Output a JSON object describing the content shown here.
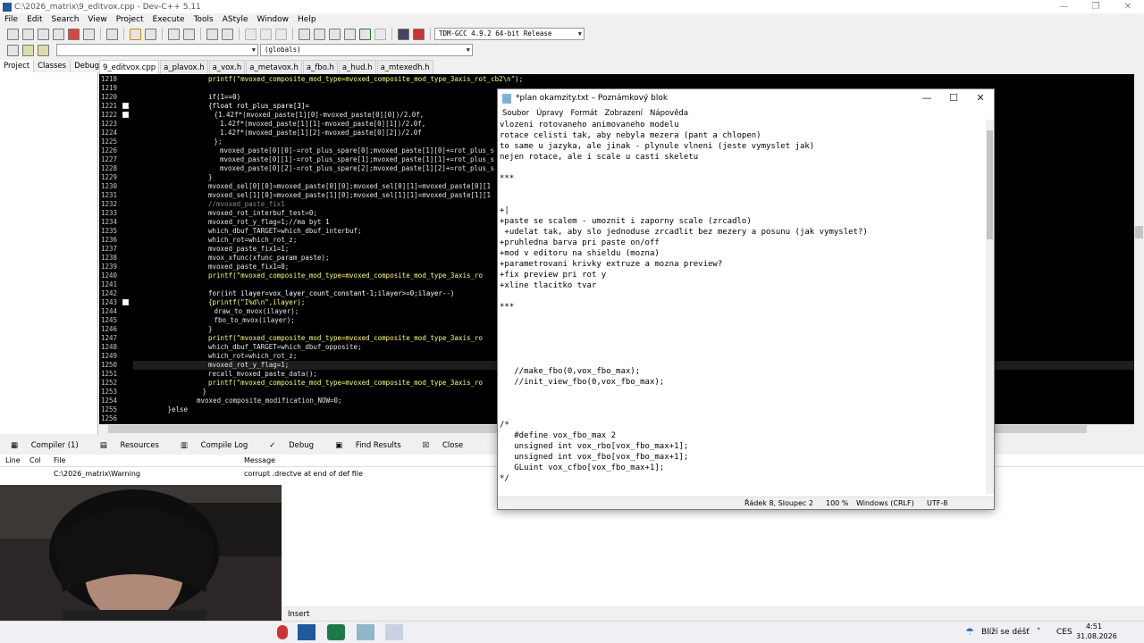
{
  "ide": {
    "title": "C:\\2026_matrix\\9_editvox.cpp - Dev-C++ 5.11",
    "menu": [
      "File",
      "Edit",
      "Search",
      "View",
      "Project",
      "Execute",
      "Tools",
      "AStyle",
      "Window",
      "Help"
    ],
    "compiler_select": "TDM-GCC 4.9.2 64-bit Release",
    "scope_select": "(globals)",
    "side_tabs": [
      "Project",
      "Classes",
      "Debug"
    ],
    "editor_tabs": [
      "9_editvox.cpp",
      "a_plavox.h",
      "a_vox.h",
      "a_metavox.h",
      "a_fbo.h",
      "a_hud.h",
      "a_mtexedh.h"
    ],
    "active_tab": "9_editvox.cpp",
    "code_lines": [
      {
        "n": "1218",
        "t": "printf(\"mvoxed_composite_mod_type=mvoxed_composite_mod_type_3axis_rot_cb2\\n\");",
        "i": 12
      },
      {
        "n": "1219",
        "t": "",
        "i": 0
      },
      {
        "n": "1220",
        "t": "if(1==0)",
        "i": 12
      },
      {
        "n": "1221",
        "t": "{float rot_plus_spare[3]=",
        "i": 12
      },
      {
        "n": "1222",
        "t": "{1.42f*(mvoxed_paste[1][0]-mvoxed_paste[0][0])/2.0f,",
        "i": 13
      },
      {
        "n": "1223",
        "t": "1.42f*(mvoxed_paste[1][1]-mvoxed_paste[0][1])/2.0f,",
        "i": 14
      },
      {
        "n": "1224",
        "t": "1.42f*(mvoxed_paste[1][2]-mvoxed_paste[0][2])/2.0f",
        "i": 14
      },
      {
        "n": "1225",
        "t": "};",
        "i": 13
      },
      {
        "n": "1226",
        "t": "mvoxed_paste[0][0]-=rot_plus_spare[0];mvoxed_paste[1][0]+=rot_plus_s",
        "i": 14
      },
      {
        "n": "1227",
        "t": "mvoxed_paste[0][1]-=rot_plus_spare[1];mvoxed_paste[1][1]+=rot_plus_s",
        "i": 14
      },
      {
        "n": "1228",
        "t": "mvoxed_paste[0][2]-=rot_plus_spare[2];mvoxed_paste[1][2]+=rot_plus_s",
        "i": 14
      },
      {
        "n": "1229",
        "t": "}",
        "i": 12
      },
      {
        "n": "1230",
        "t": "mvoxed_sel[0][0]=mvoxed_paste[0][0];mvoxed_sel[0][1]=mvoxed_paste[0][1",
        "i": 12
      },
      {
        "n": "1231",
        "t": "mvoxed_sel[1][0]=mvoxed_paste[1][0];mvoxed_sel[1][1]=mvoxed_paste[1][1",
        "i": 12
      },
      {
        "n": "1232",
        "t": "//mvoxed_paste_fix1",
        "i": 12
      },
      {
        "n": "1233",
        "t": "mvoxed_rot_interbuf_test=0;",
        "i": 12
      },
      {
        "n": "1234",
        "t": "mvoxed_rot_y_flag=1;//ma byt 1",
        "i": 12
      },
      {
        "n": "1235",
        "t": "which_dbuf_TARGET=which_dbuf_interbuf;",
        "i": 12
      },
      {
        "n": "1236",
        "t": "which_rot=which_rot_z;",
        "i": 12
      },
      {
        "n": "1237",
        "t": "mvoxed_paste_fix1=1;",
        "i": 12
      },
      {
        "n": "1238",
        "t": "mvox_xfunc(xfunc_param_paste);",
        "i": 12
      },
      {
        "n": "1239",
        "t": "mvoxed_paste_fix1=0;",
        "i": 12
      },
      {
        "n": "1240",
        "t": "printf(\"mvoxed_composite_mod_type=mvoxed_composite_mod_type_3axis_ro",
        "i": 12
      },
      {
        "n": "1241",
        "t": "",
        "i": 0
      },
      {
        "n": "1242",
        "t": "for(int ilayer=vox_layer_count_constant-1;ilayer>=0;ilayer--)",
        "i": 12
      },
      {
        "n": "1243",
        "t": "{printf(\"I%d\\n\",ilayer);",
        "i": 12
      },
      {
        "n": "1244",
        "t": "draw_to_mvox(ilayer);",
        "i": 13
      },
      {
        "n": "1245",
        "t": "fbo_to_mvox(ilayer);",
        "i": 13
      },
      {
        "n": "1246",
        "t": "}",
        "i": 12
      },
      {
        "n": "1247",
        "t": "printf(\"mvoxed_composite_mod_type=mvoxed_composite_mod_type_3axis_ro",
        "i": 12
      },
      {
        "n": "1248",
        "t": "which_dbuf_TARGET=which_dbuf_opposite;",
        "i": 12
      },
      {
        "n": "1249",
        "t": "which_rot=which_rot_z;",
        "i": 12
      },
      {
        "n": "1250",
        "t": "mvoxed_rot_y_flag=1;",
        "i": 12
      },
      {
        "n": "1251",
        "t": "recall_mvoxed_paste_data();",
        "i": 12
      },
      {
        "n": "1252",
        "t": "printf(\"mvoxed_composite_mod_type=mvoxed_composite_mod_type_3axis_ro",
        "i": 12
      },
      {
        "n": "1253",
        "t": "}",
        "i": 11
      },
      {
        "n": "1254",
        "t": "mvoxed_composite_modification_NOW=0;",
        "i": 10
      },
      {
        "n": "1255",
        "t": "}else",
        "i": 5
      },
      {
        "n": "1256",
        "t": "",
        "i": 0
      }
    ],
    "bottom_tabs": [
      "Compiler (1)",
      "Resources",
      "Compile Log",
      "Debug",
      "Find Results",
      "Close"
    ],
    "message_columns": [
      "Line",
      "Col",
      "File",
      "Message"
    ],
    "message_row": {
      "line": "",
      "col": "",
      "file": "C:\\2026_matrix\\Warning",
      "message": "corrupt .drectve at end of def file"
    },
    "status_insert": "Insert"
  },
  "notepad": {
    "title": "*plan okamzity.txt – Poznámkový blok",
    "menu": [
      "Soubor",
      "Úpravy",
      "Formát",
      "Zobrazení",
      "Nápověda"
    ],
    "text": "vlozeni rotovaneho animovaneho modelu\nrotace celisti tak, aby nebyla mezera (pant a chlopen)\nto same u jazyka, ale jinak - plynule vlneni (jeste vymyslet jak)\nnejen rotace, ale i scale u casti skeletu\n\n***\n\n\n+|\n+paste se scalem - umoznit i zaporny scale (zrcadlo)\n +udelat tak, aby slo jednoduse zrcadlit bez mezery a posunu (jak vymyslet?)\n+pruhledna barva pri paste on/off\n+mod v editoru na shieldu (mozna)\n+parametrovani krivky extruze a mozna preview?\n+fix preview pri rot y\n+xline tlacitko tvar\n\n***\n\n\n\n\n\n   //make_fbo(0,vox_fbo_max);\n   //init_view_fbo(0,vox_fbo_max);\n\n\n\n/*\n   #define vox_fbo_max 2\n   unsigned int vox_rbo[vox_fbo_max+1];\n   unsigned int vox_fbo[vox_fbo_max+1];\n   GLuint vox_cfbo[vox_fbo_max+1];\n*/",
    "status": {
      "position": "Řádek 8, Sloupec 2",
      "zoom": "100 %",
      "eol": "Windows (CRLF)",
      "encoding": "UTF-8"
    }
  },
  "taskbar": {
    "weather": "Blíží se déšť",
    "lang": "CES",
    "time": "4:51",
    "date": "31.08.2026"
  }
}
